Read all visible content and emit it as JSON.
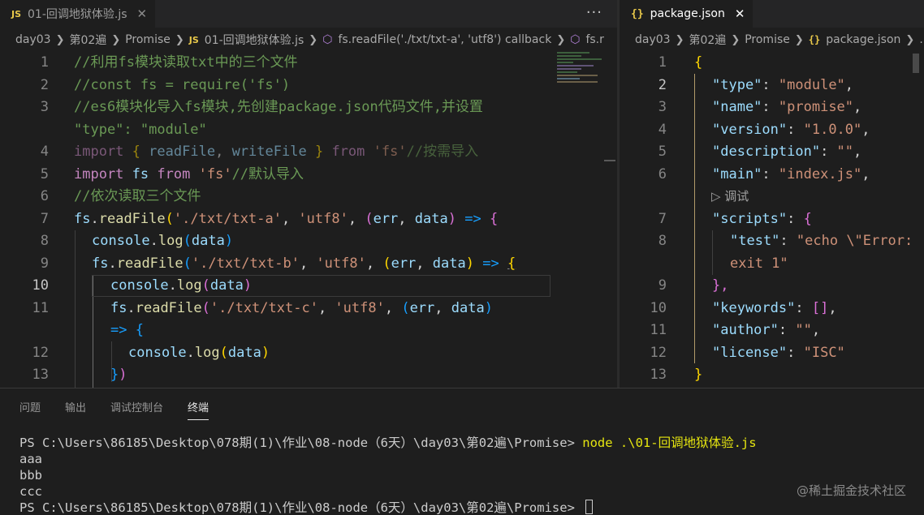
{
  "left_editor": {
    "tab": {
      "badge": "JS",
      "label": "01-回调地狱体验.js",
      "close": "✕"
    },
    "more_actions": "···",
    "breadcrumb": [
      "day03",
      "第02遍",
      "Promise",
      "01-回调地狱体验.js",
      "fs.readFile('./txt/txt-a', 'utf8') callback",
      "fs.r"
    ],
    "line_numbers": [
      "1",
      "2",
      "3",
      "",
      "4",
      "5",
      "6",
      "7",
      "8",
      "9",
      "10",
      "11",
      "",
      "12",
      "13"
    ],
    "code": {
      "l1": "//利用fs模块读取txt中的三个文件",
      "l2": "//const fs = require('fs')",
      "l3a": "//es6模块化导入fs模块,先创建package.json代码文件,并设置",
      "l3b": "\"type\": \"module\"",
      "l4_import": "import",
      "l4_open": "{",
      "l4_readFile": "readFile",
      "l4_comma": ",",
      "l4_writeFile": "writeFile",
      "l4_close": "}",
      "l4_from": "from",
      "l4_path": "'fs'",
      "l4_cmt": "//按需导入",
      "l5_import": "import",
      "l5_fs": "fs",
      "l5_from": "from",
      "l5_path": "'fs'",
      "l5_cmt": "//默认导入",
      "l6": "//依次读取三个文件",
      "fs": "fs",
      "dot": ".",
      "readFile": "readFile",
      "paren_open": "(",
      "paren_close": ")",
      "comma": ", ",
      "path_a": "'./txt/txt-a'",
      "path_b": "'./txt/txt-b'",
      "path_c": "'./txt/txt-c'",
      "utf8": "'utf8'",
      "err": "err",
      "data": "data",
      "arrow": "=>",
      "brace_open": "{",
      "brace_close": "}",
      "console": "console",
      "log": "log"
    }
  },
  "right_editor": {
    "tab": {
      "badge": "{}",
      "label": "package.json",
      "close": "✕"
    },
    "breadcrumb": [
      "day03",
      "第02遍",
      "Promise",
      "package.json",
      "..."
    ],
    "line_numbers": [
      "1",
      "2",
      "3",
      "4",
      "5",
      "6",
      "",
      "7",
      "8",
      "",
      "9",
      "10",
      "11",
      "12",
      "13"
    ],
    "codelens": "▷ 调试",
    "json": {
      "open": "{",
      "close": "}",
      "type_key": "\"type\"",
      "type_val": "\"module\"",
      "name_key": "\"name\"",
      "name_val": "\"promise\"",
      "version_key": "\"version\"",
      "version_val": "\"1.0.0\"",
      "description_key": "\"description\"",
      "description_val": "\"\"",
      "main_key": "\"main\"",
      "main_val": "\"index.js\"",
      "scripts_key": "\"scripts\"",
      "test_key": "\"test\"",
      "test_val_a": "\"echo \\\"Error:",
      "test_val_b": "exit 1\"",
      "scripts_close": "},",
      "keywords_key": "\"keywords\"",
      "keywords_val": "[]",
      "author_key": "\"author\"",
      "author_val": "\"\"",
      "license_key": "\"license\"",
      "license_val": "\"ISC\""
    }
  },
  "panel": {
    "tabs": [
      "问题",
      "输出",
      "调试控制台",
      "终端"
    ],
    "active_tab": "终端",
    "terminal": {
      "prompt": "PS C:\\Users\\86185\\Desktop\\078期(1)\\作业\\08-node（6天）\\day03\\第02遍\\Promise> ",
      "command": "node .\\01-回调地狱体验.js",
      "outputs": [
        "aaa",
        "bbb",
        "ccc"
      ]
    },
    "watermark": "@稀土掘金技术社区"
  },
  "colors": {
    "background": "#1e1e1e",
    "comment": "#6a9955",
    "keyword": "#c586c0",
    "string": "#ce9178",
    "function": "#dcdcaa",
    "variable": "#9cdcfe"
  }
}
